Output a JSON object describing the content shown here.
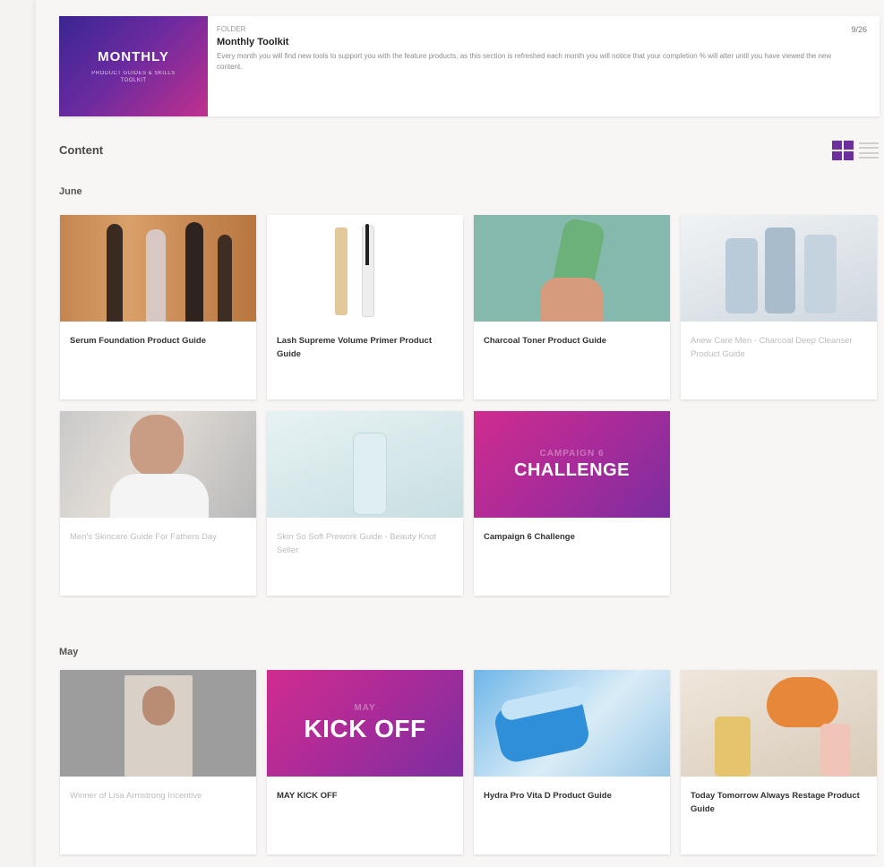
{
  "header": {
    "thumb_title": "MONTHLY",
    "thumb_subtitle": "PRODUCT GUIDES & SKILLS TOOLKIT",
    "kicker": "FOLDER",
    "title": "Monthly Toolkit",
    "description": "Every month you will find new tools to support you with the feature products, as this section is refreshed each month you will notice that your completion % will alter until you have viewed the new content.",
    "progress": "9/26"
  },
  "content": {
    "section_title": "Content",
    "view_modes": [
      "grid",
      "list"
    ],
    "active_view": "grid",
    "months": [
      {
        "label": "June",
        "items": [
          {
            "title": "Serum Foundation Product Guide",
            "thumb": "foundation-bottles",
            "viewed": true
          },
          {
            "title": "Lash Supreme Volume Primer Product Guide",
            "thumb": "mascara-primer",
            "viewed": true
          },
          {
            "title": "Charcoal Toner Product Guide",
            "thumb": "toner-bottle",
            "viewed": true
          },
          {
            "title": "Anew Care Men - Charcoal Deep Cleanser Product Guide",
            "thumb": "men-charcoal-products",
            "viewed": false
          },
          {
            "title": "Men's Skincare Guide For Fathers Day",
            "thumb": "man-skincare-photo",
            "viewed": false
          },
          {
            "title": "Skin So Soft Prework Guide - Beauty Knot Seller",
            "thumb": "skin-so-soft-products",
            "viewed": false
          },
          {
            "title": "Campaign 6 Challenge",
            "thumb_sub": "CAMPAIGN 6",
            "thumb_main": "CHALLENGE",
            "thumb": "campaign-banner",
            "viewed": true
          }
        ]
      },
      {
        "label": "May",
        "items": [
          {
            "title": "Winner of Lisa Armstrong Incentive",
            "thumb": "winner-photo",
            "viewed": false
          },
          {
            "title": "MAY KICK OFF",
            "thumb_sub": "MAY",
            "thumb_main": "KICK OFF",
            "thumb": "kickoff-banner",
            "viewed": true
          },
          {
            "title": "Hydra Pro Vita D Product Guide",
            "thumb": "hydra-jar",
            "viewed": true
          },
          {
            "title": "Today Tomorrow Always Restage Product Guide",
            "thumb": "perfume-bottles",
            "viewed": true
          }
        ]
      }
    ]
  },
  "colors": {
    "brand_purple": "#6b2f9e",
    "brand_magenta": "#c0308e"
  }
}
